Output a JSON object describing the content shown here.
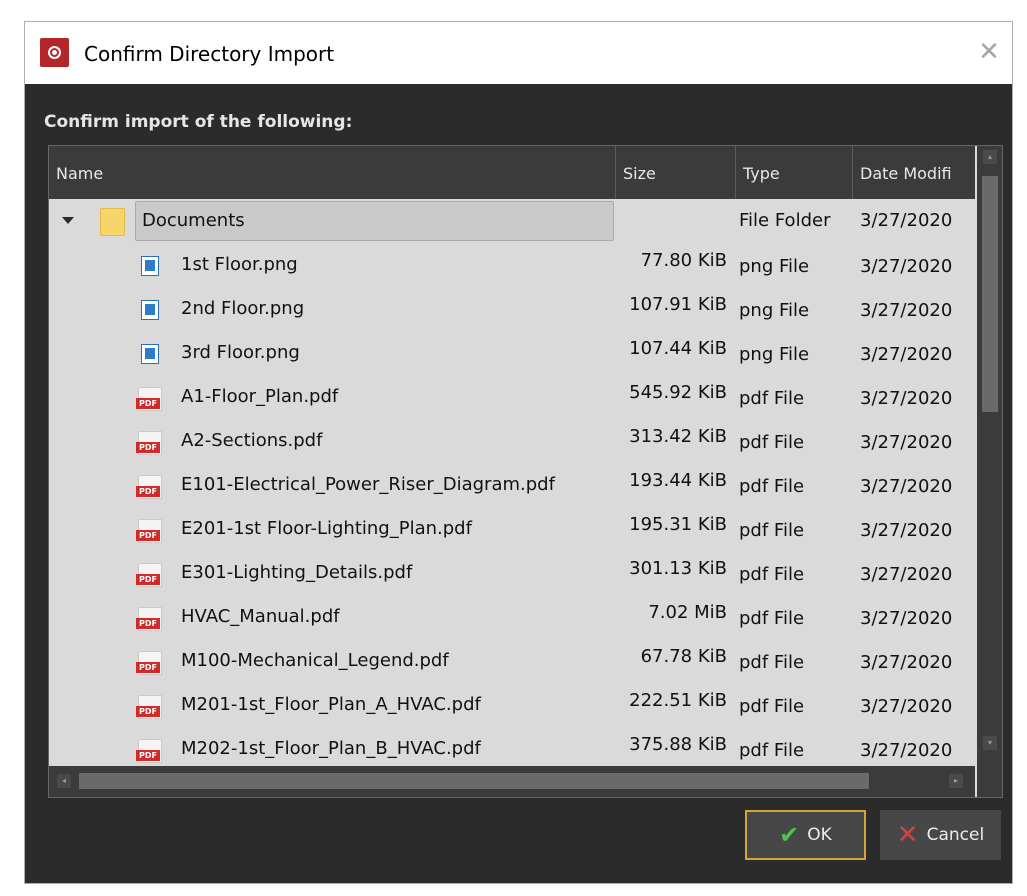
{
  "window": {
    "title": "Confirm Directory Import"
  },
  "heading": "Confirm import of the following:",
  "columns": [
    "Name",
    "Size",
    "Type",
    "Date Modifi"
  ],
  "folder": {
    "name": "Documents",
    "type": "File Folder",
    "date": "3/27/2020"
  },
  "files": [
    {
      "name": "1st Floor.png",
      "size": "77.80 KiB",
      "type": "png File",
      "date": "3/27/2020",
      "icon": "png-file-icon"
    },
    {
      "name": "2nd Floor.png",
      "size": "107.91 KiB",
      "type": "png File",
      "date": "3/27/2020",
      "icon": "png-file-icon"
    },
    {
      "name": "3rd Floor.png",
      "size": "107.44 KiB",
      "type": "png File",
      "date": "3/27/2020",
      "icon": "png-file-icon"
    },
    {
      "name": "A1-Floor_Plan.pdf",
      "size": "545.92 KiB",
      "type": "pdf File",
      "date": "3/27/2020",
      "icon": "pdf-file-icon"
    },
    {
      "name": "A2-Sections.pdf",
      "size": "313.42 KiB",
      "type": "pdf File",
      "date": "3/27/2020",
      "icon": "pdf-file-icon"
    },
    {
      "name": "E101-Electrical_Power_Riser_Diagram.pdf",
      "size": "193.44 KiB",
      "type": "pdf File",
      "date": "3/27/2020",
      "icon": "pdf-file-icon"
    },
    {
      "name": "E201-1st Floor-Lighting_Plan.pdf",
      "size": "195.31 KiB",
      "type": "pdf File",
      "date": "3/27/2020",
      "icon": "pdf-file-icon"
    },
    {
      "name": "E301-Lighting_Details.pdf",
      "size": "301.13 KiB",
      "type": "pdf File",
      "date": "3/27/2020",
      "icon": "pdf-file-icon"
    },
    {
      "name": "HVAC_Manual.pdf",
      "size": "7.02 MiB",
      "type": "pdf File",
      "date": "3/27/2020",
      "icon": "pdf-file-icon"
    },
    {
      "name": "M100-Mechanical_Legend.pdf",
      "size": "67.78 KiB",
      "type": "pdf File",
      "date": "3/27/2020",
      "icon": "pdf-file-icon"
    },
    {
      "name": "M201-1st_Floor_Plan_A_HVAC.pdf",
      "size": "222.51 KiB",
      "type": "pdf File",
      "date": "3/27/2020",
      "icon": "pdf-file-icon"
    },
    {
      "name": "M202-1st_Floor_Plan_B_HVAC.pdf",
      "size": "375.88 KiB",
      "type": "pdf File",
      "date": "3/27/2020",
      "icon": "pdf-file-icon"
    }
  ],
  "pdf_label": "PDF",
  "buttons": {
    "ok": "OK",
    "cancel": "Cancel"
  },
  "colors": {
    "accent": "#d9a33a",
    "ok_check": "#4fc24f",
    "cancel_x": "#d94040",
    "app_icon": "#b3262a"
  }
}
